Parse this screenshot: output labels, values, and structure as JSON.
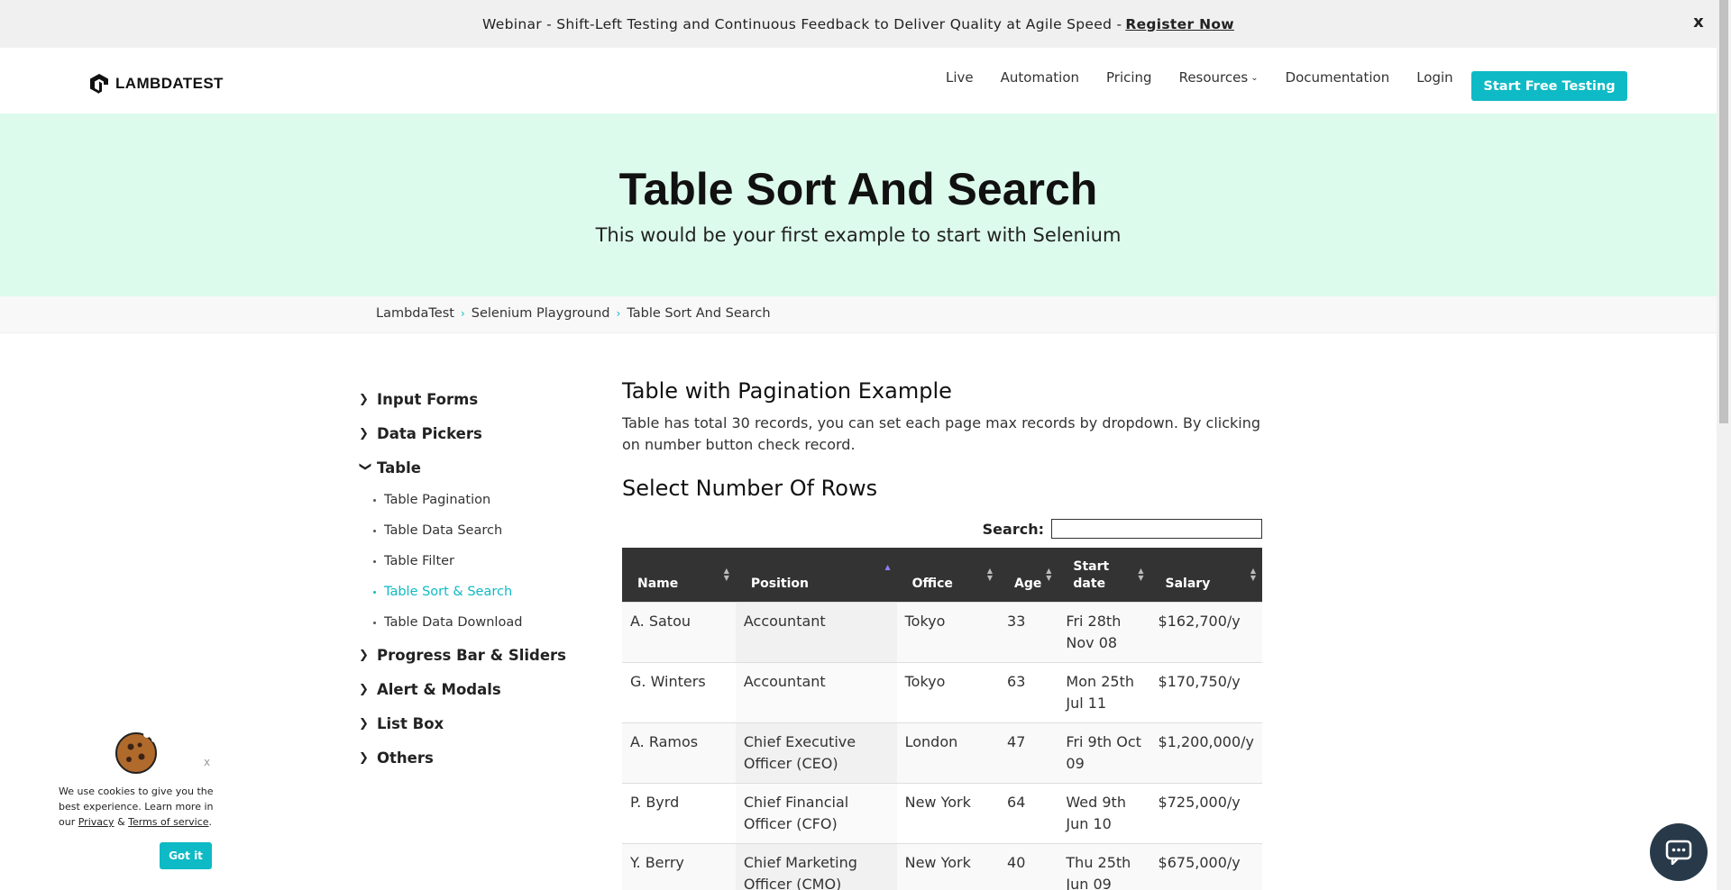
{
  "banner": {
    "text": "Webinar - Shift-Left Testing and Continuous Feedback to Deliver Quality at Agile Speed -",
    "link": "Register Now",
    "close": "x"
  },
  "header": {
    "logo_text": "LAMBDATEST",
    "nav": [
      "Live",
      "Automation",
      "Pricing",
      "Resources",
      "Documentation",
      "Login"
    ],
    "cta": "Start Free Testing"
  },
  "hero": {
    "title": "Table Sort And Search",
    "subtitle": "This would be your first example to start with Selenium"
  },
  "breadcrumb": [
    "LambdaTest",
    "Selenium Playground",
    "Table Sort And Search"
  ],
  "sidebar": {
    "items": [
      {
        "label": "Input Forms",
        "expanded": false
      },
      {
        "label": "Data Pickers",
        "expanded": false
      },
      {
        "label": "Table",
        "expanded": true,
        "children": [
          "Table Pagination",
          "Table Data Search",
          "Table Filter",
          "Table Sort & Search",
          "Table Data Download"
        ]
      },
      {
        "label": "Progress Bar & Sliders",
        "expanded": false
      },
      {
        "label": "Alert & Modals",
        "expanded": false
      },
      {
        "label": "List Box",
        "expanded": false
      },
      {
        "label": "Others",
        "expanded": false
      }
    ],
    "active_child": "Table Sort & Search"
  },
  "main": {
    "title": "Table with Pagination Example",
    "description": "Table has total 30 records, you can set each page max records by dropdown. By clicking on number button check record.",
    "subtitle": "Select Number Of Rows",
    "search_label": "Search:",
    "search_value": "",
    "table": {
      "columns": [
        "Name",
        "Position",
        "Office",
        "Age",
        "Start date",
        "Salary"
      ],
      "sorted_column": "Position",
      "rows": [
        [
          "A. Satou",
          "Accountant",
          "Tokyo",
          "33",
          "Fri 28th Nov 08",
          "$162,700/y"
        ],
        [
          "G. Winters",
          "Accountant",
          "Tokyo",
          "63",
          "Mon 25th Jul 11",
          "$170,750/y"
        ],
        [
          "A. Ramos",
          "Chief Executive Officer (CEO)",
          "London",
          "47",
          "Fri 9th Oct 09",
          "$1,200,000/y"
        ],
        [
          "P. Byrd",
          "Chief Financial Officer (CFO)",
          "New York",
          "64",
          "Wed 9th Jun 10",
          "$725,000/y"
        ],
        [
          "Y. Berry",
          "Chief Marketing Officer (CMO)",
          "New York",
          "40",
          "Thu 25th Jun 09",
          "$675,000/y"
        ]
      ]
    }
  },
  "cookie": {
    "close": "x",
    "text_before": "We use cookies to give you the best experience. Learn more in our",
    "privacy": "Privacy",
    "amp": "&",
    "terms": "Terms of service",
    "period": ".",
    "button": "Got it"
  }
}
